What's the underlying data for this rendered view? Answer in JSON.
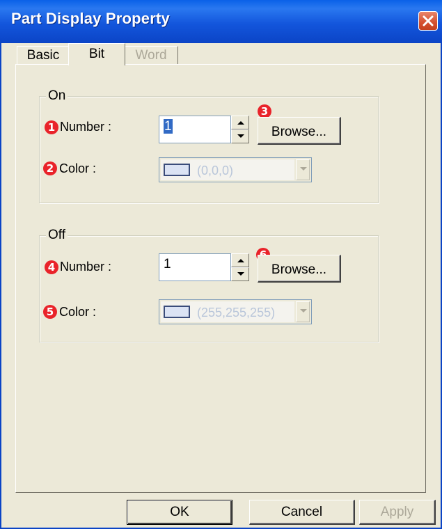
{
  "window": {
    "title": "Part Display Property"
  },
  "tabs": [
    {
      "label": "Basic"
    },
    {
      "label": "Bit"
    },
    {
      "label": "Word"
    }
  ],
  "on": {
    "legend": "On",
    "number": {
      "marker": "1",
      "label": "Number :",
      "value": "1"
    },
    "browse": {
      "marker": "3",
      "label": "Browse..."
    },
    "color": {
      "marker": "2",
      "label": "Color :",
      "value": "(0,0,0)",
      "swatch": "#dbe3f4"
    }
  },
  "off": {
    "legend": "Off",
    "number": {
      "marker": "4",
      "label": "Number :",
      "value": "1"
    },
    "browse": {
      "marker": "6",
      "label": "Browse..."
    },
    "color": {
      "marker": "5",
      "label": "Color :",
      "value": "(255,255,255)",
      "swatch": "#dbe3f4"
    }
  },
  "footer": {
    "ok": "OK",
    "cancel": "Cancel",
    "apply": "Apply"
  },
  "colors": {
    "title_bar": "#0b44c6",
    "marker": "#e9232a",
    "selection": "#316ac5"
  }
}
